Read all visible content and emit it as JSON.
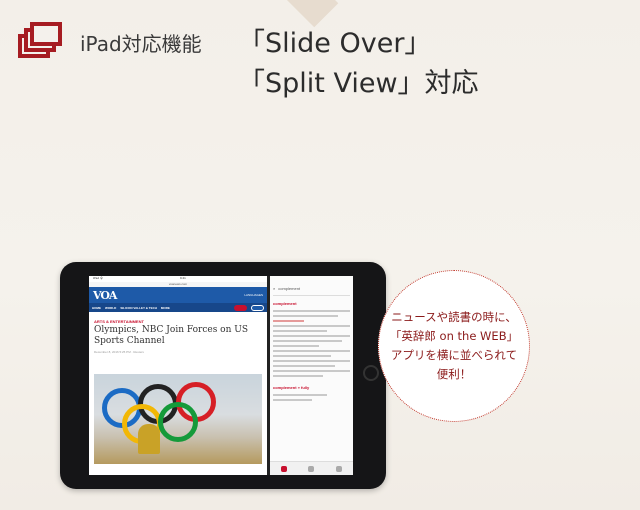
{
  "header": {
    "label": "iPad対応機能",
    "title_line1": "「Slide Over」",
    "title_line2": "「Split View」対応"
  },
  "tablet": {
    "status_left": "iPad 令",
    "status_time": "9:41",
    "url": "voanews.com",
    "news": {
      "site_logo": "VOA",
      "language": "LANGUAGES",
      "nav": [
        "HOME",
        "WORLD",
        "SILICON VALLEY & TECH",
        "MORE"
      ],
      "listen": "LISTEN",
      "watch": "WATCH",
      "section": "ARTS & ENTERTAINMENT",
      "headline": "Olympics, NBC Join Forces on US Sports Channel",
      "byline": "December 8, 2016 5:25 PM · Reuters"
    },
    "dictionary": {
      "search_placeholder": "complement",
      "entry1": "complement",
      "entry2": "complement » fully"
    }
  },
  "callout": {
    "line1": "ニュースや読書の時に、",
    "line2": "「英辞郎 on the WEB」",
    "line3": "アプリを横に並べられて",
    "line4": "便利！"
  },
  "colors": {
    "accent": "#a61c22",
    "voa_blue": "#1e5aa8",
    "callout_text": "#8b1a1a"
  }
}
